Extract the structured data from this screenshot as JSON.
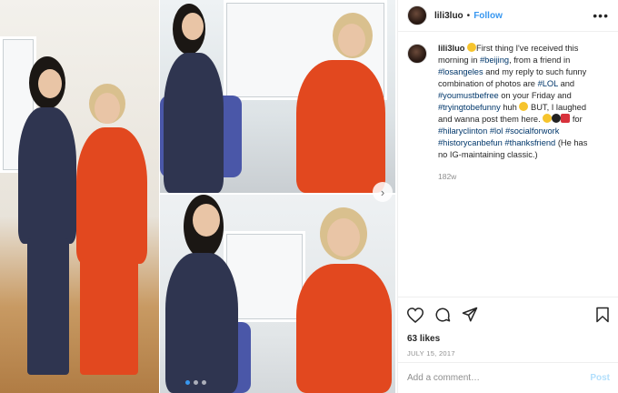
{
  "post": {
    "username": "lili3luo",
    "follow_label": "Follow",
    "separator": "•",
    "more_label": "•••",
    "caption": {
      "username": "lili3luo",
      "parts": [
        {
          "t": "text",
          "v": " "
        },
        {
          "t": "emoji",
          "v": "e-yellow"
        },
        {
          "t": "text",
          "v": "First thing I've received this morning in "
        },
        {
          "t": "tag",
          "v": "#beijing"
        },
        {
          "t": "text",
          "v": ", from a friend in "
        },
        {
          "t": "tag",
          "v": "#losangeles"
        },
        {
          "t": "text",
          "v": " and my reply to such funny combination of photos are "
        },
        {
          "t": "tag",
          "v": "#LOL"
        },
        {
          "t": "text",
          "v": " and "
        },
        {
          "t": "tag",
          "v": "#youmustbefree"
        },
        {
          "t": "text",
          "v": " on your Friday and "
        },
        {
          "t": "tag",
          "v": "#tryingtobefunny"
        },
        {
          "t": "text",
          "v": " huh "
        },
        {
          "t": "emoji",
          "v": "e-yellow"
        },
        {
          "t": "text",
          "v": " BUT, I laughed and wanna post them here. "
        },
        {
          "t": "emoji",
          "v": "e-yellow"
        },
        {
          "t": "emoji",
          "v": "e-black"
        },
        {
          "t": "emoji",
          "v": "e-red"
        },
        {
          "t": "text",
          "v": " for "
        },
        {
          "t": "tag",
          "v": "#hilaryclinton"
        },
        {
          "t": "text",
          "v": " "
        },
        {
          "t": "tag",
          "v": "#lol"
        },
        {
          "t": "text",
          "v": " "
        },
        {
          "t": "tag",
          "v": "#socialforwork"
        },
        {
          "t": "text",
          "v": " "
        },
        {
          "t": "tag",
          "v": "#historycanbefun"
        },
        {
          "t": "text",
          "v": " "
        },
        {
          "t": "tag",
          "v": "#thanksfriend"
        },
        {
          "t": "text",
          "v": " (He has no IG-maintaining classic.)"
        }
      ]
    },
    "time_ago": "182w",
    "likes": "63 likes",
    "date": "JULY 15, 2017",
    "comment_placeholder": "Add a comment…",
    "post_label": "Post",
    "carousel": {
      "slides": 3,
      "active_index": 0,
      "next_arrow": "›"
    },
    "icons": [
      "heart-icon",
      "comment-icon",
      "share-icon",
      "bookmark-icon"
    ],
    "colors": {
      "link": "#3897f0",
      "hashtag": "#00376b",
      "muted": "#8e8e8e"
    }
  }
}
